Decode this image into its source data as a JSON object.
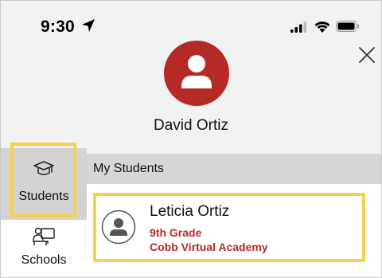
{
  "status_bar": {
    "time": "9:30",
    "icons": [
      "location-arrow-icon",
      "cellular-signal-icon",
      "wifi-icon",
      "battery-icon"
    ]
  },
  "header": {
    "close_icon": "close-icon",
    "avatar_icon": "user-avatar-icon",
    "user_name": "David Ortiz"
  },
  "sidebar": {
    "items": [
      {
        "label": "Students",
        "icon": "graduation-cap-icon",
        "selected": true
      },
      {
        "label": "Schools",
        "icon": "school-icon",
        "selected": false
      }
    ]
  },
  "main": {
    "section_title": "My Students",
    "students": [
      {
        "name": "Leticia Ortiz",
        "grade": "9th Grade",
        "school": "Cobb Virtual Academy",
        "avatar_icon": "student-avatar-icon"
      }
    ]
  },
  "colors": {
    "brand_red": "#b52a26",
    "highlight_yellow": "#f4d24b",
    "selected_gray": "#d3d3d3",
    "header_gray": "#d6d6d6"
  }
}
